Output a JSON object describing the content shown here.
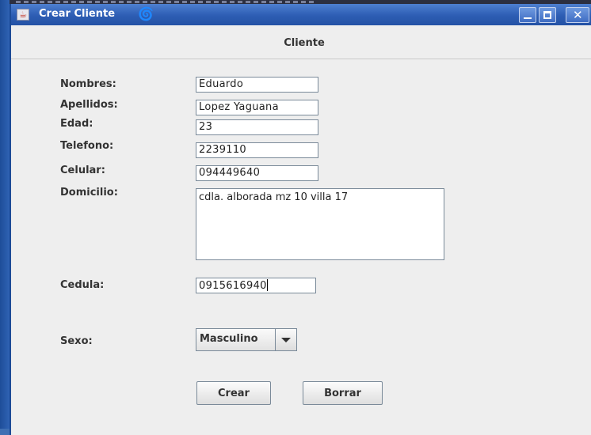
{
  "window": {
    "title": "Crear Cliente",
    "app_icon": "java-cup-icon",
    "title_icon": "swirl-icon",
    "close_glyph": "✕"
  },
  "header": {
    "title": "Cliente"
  },
  "form": {
    "nombres": {
      "label": "Nombres:",
      "value": "Eduardo"
    },
    "apellidos": {
      "label": "Apellidos:",
      "value": "Lopez Yaguana"
    },
    "edad": {
      "label": "Edad:",
      "value": "23"
    },
    "telefono": {
      "label": "Telefono:",
      "value": "2239110"
    },
    "celular": {
      "label": "Celular:",
      "value": "094449640"
    },
    "domicilio": {
      "label": "Domicilio:",
      "value": "cdla. alborada mz 10 villa 17"
    },
    "cedula": {
      "label": "Cedula:",
      "value": "0915616940"
    },
    "sexo": {
      "label": "Sexo:",
      "value": "Masculino"
    }
  },
  "buttons": {
    "crear": "Crear",
    "borrar": "Borrar"
  },
  "colors": {
    "titlebar": "#2d5db3",
    "window_bg": "#eeeeee",
    "desktop": "#3f6fb3"
  }
}
